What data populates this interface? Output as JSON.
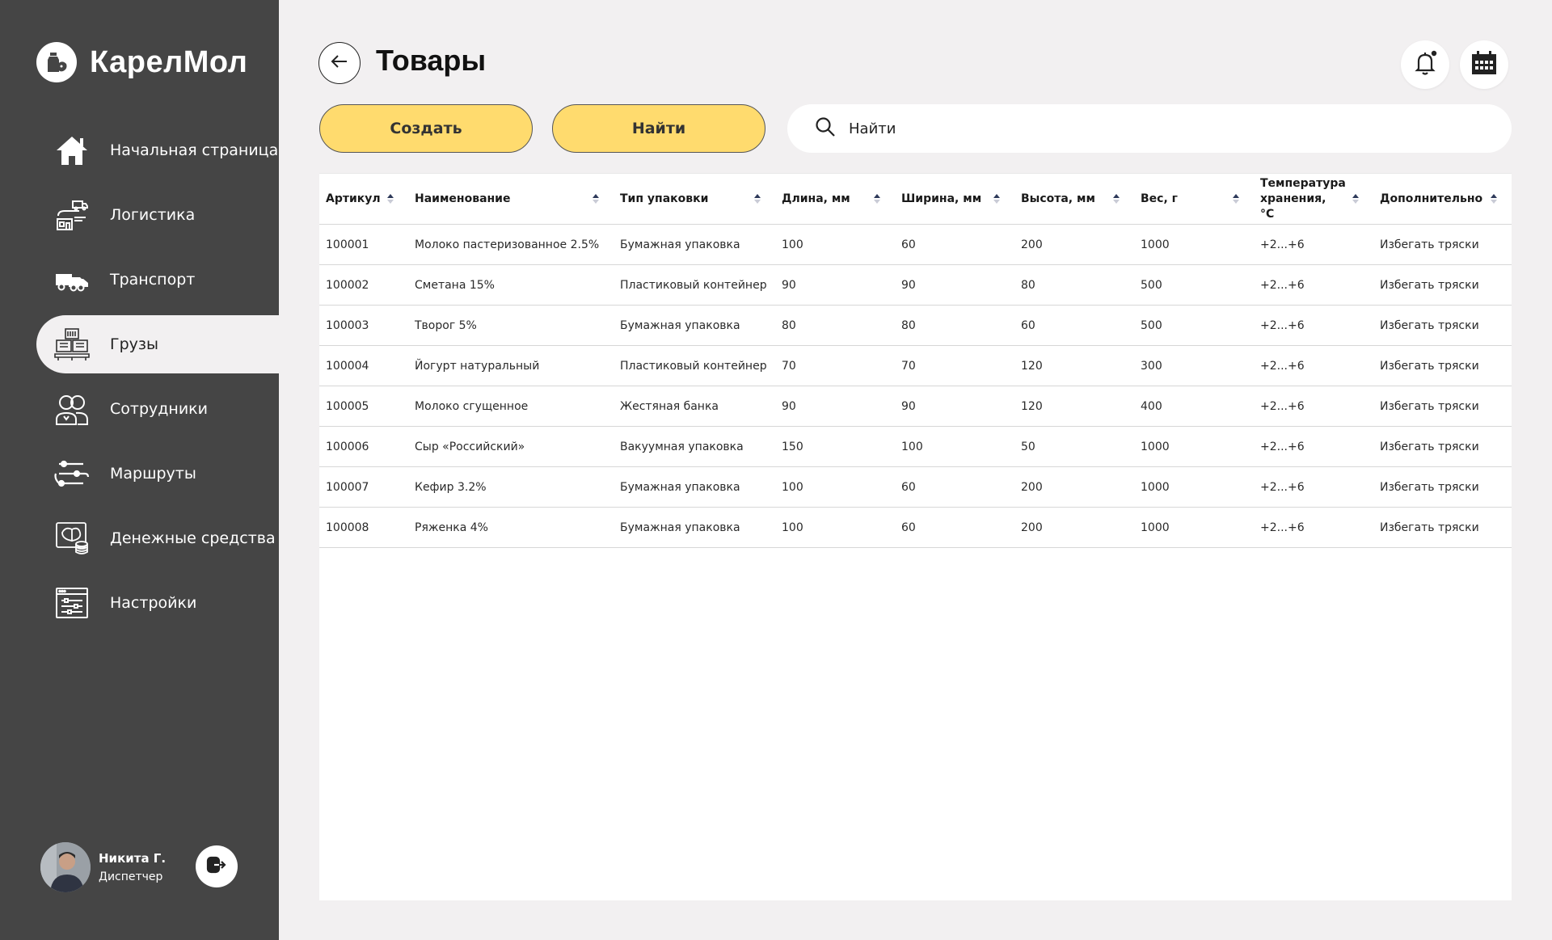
{
  "app": {
    "brand": "КарелМол"
  },
  "sidebar": {
    "items": [
      {
        "label": "Начальная страница",
        "icon": "home-icon",
        "active": false
      },
      {
        "label": "Логистика",
        "icon": "logistics-icon",
        "active": false
      },
      {
        "label": "Транспорт",
        "icon": "truck-icon",
        "active": false
      },
      {
        "label": "Грузы",
        "icon": "cargo-icon",
        "active": true
      },
      {
        "label": "Сотрудники",
        "icon": "employees-icon",
        "active": false
      },
      {
        "label": "Маршруты",
        "icon": "routes-icon",
        "active": false
      },
      {
        "label": "Денежные средства",
        "icon": "money-icon",
        "active": false
      },
      {
        "label": "Настройки",
        "icon": "settings-icon",
        "active": false
      }
    ],
    "user": {
      "name": "Никита Г.",
      "role": "Диспетчер"
    }
  },
  "header": {
    "title": "Товары",
    "notification_dot": true
  },
  "toolbar": {
    "create_label": "Создать",
    "find_label": "Найти",
    "search_placeholder": "Найти",
    "search_value": ""
  },
  "colors": {
    "sidebar_bg": "#454545",
    "page_bg": "#f2f0f1",
    "accent_yellow": "#ffdb6e"
  },
  "table": {
    "columns": [
      "Артикул",
      "Наименование",
      "Тип упаковки",
      "Длина, мм",
      "Ширина, мм",
      "Высота, мм",
      "Вес, г",
      "Температура хранения, °C",
      "Дополнительно"
    ],
    "rows": [
      [
        "100001",
        "Молоко пастеризованное 2.5%",
        "Бумажная упаковка",
        "100",
        "60",
        "200",
        "1000",
        "+2...+6",
        "Избегать тряски"
      ],
      [
        "100002",
        "Сметана 15%",
        "Пластиковый контейнер",
        "90",
        "90",
        "80",
        "500",
        "+2...+6",
        "Избегать тряски"
      ],
      [
        "100003",
        "Творог 5%",
        "Бумажная упаковка",
        "80",
        "80",
        "60",
        "500",
        "+2...+6",
        "Избегать тряски"
      ],
      [
        "100004",
        "Йогурт натуральный",
        "Пластиковый контейнер",
        "70",
        "70",
        "120",
        "300",
        "+2...+6",
        "Избегать тряски"
      ],
      [
        "100005",
        "Молоко сгущенное",
        "Жестяная банка",
        "90",
        "90",
        "120",
        "400",
        "+2...+6",
        "Избегать тряски"
      ],
      [
        "100006",
        "Сыр «Российский»",
        "Вакуумная упаковка",
        "150",
        "100",
        "50",
        "1000",
        "+2...+6",
        "Избегать тряски"
      ],
      [
        "100007",
        "Кефир 3.2%",
        "Бумажная упаковка",
        "100",
        "60",
        "200",
        "1000",
        "+2...+6",
        "Избегать тряски"
      ],
      [
        "100008",
        "Ряженка 4%",
        "Бумажная упаковка",
        "100",
        "60",
        "200",
        "1000",
        "+2...+6",
        "Избегать тряски"
      ]
    ]
  }
}
